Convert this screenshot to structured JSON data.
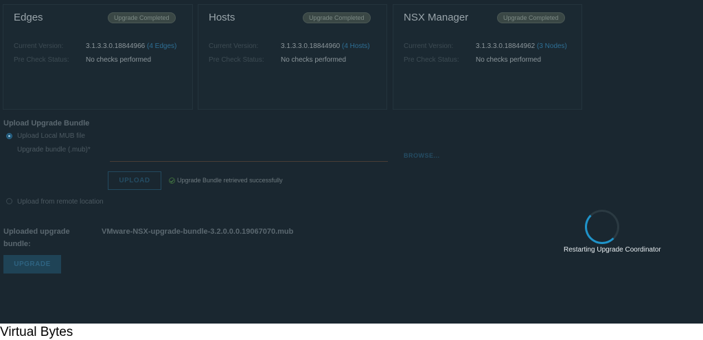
{
  "cards": {
    "edges": {
      "title": "Edges",
      "badge": "Upgrade Completed",
      "version_label": "Current Version:",
      "version_value": "3.1.3.3.0.18844966",
      "version_link": "(4 Edges)",
      "precheck_label": "Pre Check Status:",
      "precheck_value": "No checks performed"
    },
    "hosts": {
      "title": "Hosts",
      "badge": "Upgrade Completed",
      "version_label": "Current Version:",
      "version_value": "3.1.3.3.0.18844960",
      "version_link": "(4 Hosts)",
      "precheck_label": "Pre Check Status:",
      "precheck_value": "No checks performed"
    },
    "nsx": {
      "title": "NSX Manager",
      "badge": "Upgrade Completed",
      "version_label": "Current Version:",
      "version_value": "3.1.3.3.0.18844962",
      "version_link": "(3 Nodes)",
      "precheck_label": "Pre Check Status:",
      "precheck_value": "No checks performed"
    }
  },
  "upload": {
    "section_title": "Upload Upgrade Bundle",
    "local_option": "Upload Local MUB file",
    "field_label": "Upgrade bundle (.mub)*",
    "field_value": "",
    "browse_label": "BROWSE...",
    "upload_label": "UPLOAD",
    "success_message": "Upgrade Bundle retrieved successfully",
    "remote_option": "Upload from remote location"
  },
  "uploaded": {
    "label": "Uploaded upgrade bundle:",
    "value": "VMware-NSX-upgrade-bundle-3.2.0.0.0.19067070.mub",
    "upgrade_label": "UPGRADE"
  },
  "overlay": {
    "spinner_text": "Restarting Upgrade Coordinator"
  },
  "watermark": "Virtual Bytes",
  "icons": {
    "local_radio": "radio-checked",
    "remote_radio": "radio-unchecked",
    "success": "check-circle-icon",
    "spinner": "loading-spinner-icon"
  },
  "colors": {
    "background": "#1a2730",
    "accent": "#1f93c9",
    "link": "#2e6f95",
    "success": "#4e8a4a"
  }
}
